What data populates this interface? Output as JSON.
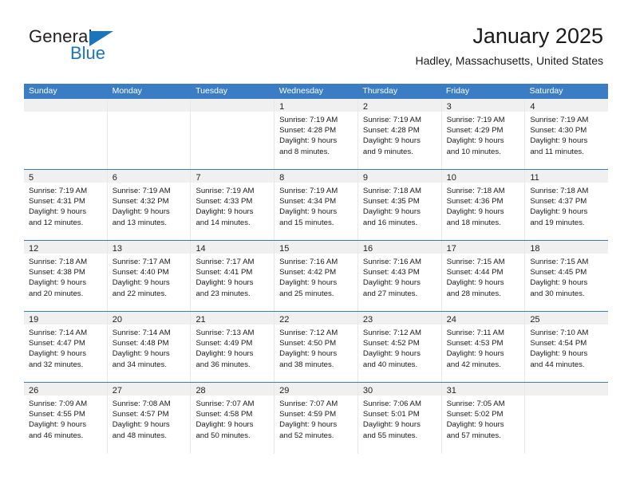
{
  "logo": {
    "word_top": "General",
    "word_bottom": "Blue",
    "triangle_color": "#1b75bb",
    "icon": "triangle-icon"
  },
  "header": {
    "title": "January 2025",
    "subtitle": "Hadley, Massachusetts, United States"
  },
  "theme": {
    "header_blue": "#3b7dc4",
    "day_band_gray": "#f0f0f0",
    "separator_blue": "#3b7dc4",
    "cell_border": "#e8e8e8"
  },
  "weekdays": [
    "Sunday",
    "Monday",
    "Tuesday",
    "Wednesday",
    "Thursday",
    "Friday",
    "Saturday"
  ],
  "weeks": [
    [
      {
        "day": "",
        "lines": []
      },
      {
        "day": "",
        "lines": []
      },
      {
        "day": "",
        "lines": []
      },
      {
        "day": "1",
        "lines": [
          "Sunrise: 7:19 AM",
          "Sunset: 4:28 PM",
          "Daylight: 9 hours",
          "and 8 minutes."
        ]
      },
      {
        "day": "2",
        "lines": [
          "Sunrise: 7:19 AM",
          "Sunset: 4:28 PM",
          "Daylight: 9 hours",
          "and 9 minutes."
        ]
      },
      {
        "day": "3",
        "lines": [
          "Sunrise: 7:19 AM",
          "Sunset: 4:29 PM",
          "Daylight: 9 hours",
          "and 10 minutes."
        ]
      },
      {
        "day": "4",
        "lines": [
          "Sunrise: 7:19 AM",
          "Sunset: 4:30 PM",
          "Daylight: 9 hours",
          "and 11 minutes."
        ]
      }
    ],
    [
      {
        "day": "5",
        "lines": [
          "Sunrise: 7:19 AM",
          "Sunset: 4:31 PM",
          "Daylight: 9 hours",
          "and 12 minutes."
        ]
      },
      {
        "day": "6",
        "lines": [
          "Sunrise: 7:19 AM",
          "Sunset: 4:32 PM",
          "Daylight: 9 hours",
          "and 13 minutes."
        ]
      },
      {
        "day": "7",
        "lines": [
          "Sunrise: 7:19 AM",
          "Sunset: 4:33 PM",
          "Daylight: 9 hours",
          "and 14 minutes."
        ]
      },
      {
        "day": "8",
        "lines": [
          "Sunrise: 7:19 AM",
          "Sunset: 4:34 PM",
          "Daylight: 9 hours",
          "and 15 minutes."
        ]
      },
      {
        "day": "9",
        "lines": [
          "Sunrise: 7:18 AM",
          "Sunset: 4:35 PM",
          "Daylight: 9 hours",
          "and 16 minutes."
        ]
      },
      {
        "day": "10",
        "lines": [
          "Sunrise: 7:18 AM",
          "Sunset: 4:36 PM",
          "Daylight: 9 hours",
          "and 18 minutes."
        ]
      },
      {
        "day": "11",
        "lines": [
          "Sunrise: 7:18 AM",
          "Sunset: 4:37 PM",
          "Daylight: 9 hours",
          "and 19 minutes."
        ]
      }
    ],
    [
      {
        "day": "12",
        "lines": [
          "Sunrise: 7:18 AM",
          "Sunset: 4:38 PM",
          "Daylight: 9 hours",
          "and 20 minutes."
        ]
      },
      {
        "day": "13",
        "lines": [
          "Sunrise: 7:17 AM",
          "Sunset: 4:40 PM",
          "Daylight: 9 hours",
          "and 22 minutes."
        ]
      },
      {
        "day": "14",
        "lines": [
          "Sunrise: 7:17 AM",
          "Sunset: 4:41 PM",
          "Daylight: 9 hours",
          "and 23 minutes."
        ]
      },
      {
        "day": "15",
        "lines": [
          "Sunrise: 7:16 AM",
          "Sunset: 4:42 PM",
          "Daylight: 9 hours",
          "and 25 minutes."
        ]
      },
      {
        "day": "16",
        "lines": [
          "Sunrise: 7:16 AM",
          "Sunset: 4:43 PM",
          "Daylight: 9 hours",
          "and 27 minutes."
        ]
      },
      {
        "day": "17",
        "lines": [
          "Sunrise: 7:15 AM",
          "Sunset: 4:44 PM",
          "Daylight: 9 hours",
          "and 28 minutes."
        ]
      },
      {
        "day": "18",
        "lines": [
          "Sunrise: 7:15 AM",
          "Sunset: 4:45 PM",
          "Daylight: 9 hours",
          "and 30 minutes."
        ]
      }
    ],
    [
      {
        "day": "19",
        "lines": [
          "Sunrise: 7:14 AM",
          "Sunset: 4:47 PM",
          "Daylight: 9 hours",
          "and 32 minutes."
        ]
      },
      {
        "day": "20",
        "lines": [
          "Sunrise: 7:14 AM",
          "Sunset: 4:48 PM",
          "Daylight: 9 hours",
          "and 34 minutes."
        ]
      },
      {
        "day": "21",
        "lines": [
          "Sunrise: 7:13 AM",
          "Sunset: 4:49 PM",
          "Daylight: 9 hours",
          "and 36 minutes."
        ]
      },
      {
        "day": "22",
        "lines": [
          "Sunrise: 7:12 AM",
          "Sunset: 4:50 PM",
          "Daylight: 9 hours",
          "and 38 minutes."
        ]
      },
      {
        "day": "23",
        "lines": [
          "Sunrise: 7:12 AM",
          "Sunset: 4:52 PM",
          "Daylight: 9 hours",
          "and 40 minutes."
        ]
      },
      {
        "day": "24",
        "lines": [
          "Sunrise: 7:11 AM",
          "Sunset: 4:53 PM",
          "Daylight: 9 hours",
          "and 42 minutes."
        ]
      },
      {
        "day": "25",
        "lines": [
          "Sunrise: 7:10 AM",
          "Sunset: 4:54 PM",
          "Daylight: 9 hours",
          "and 44 minutes."
        ]
      }
    ],
    [
      {
        "day": "26",
        "lines": [
          "Sunrise: 7:09 AM",
          "Sunset: 4:55 PM",
          "Daylight: 9 hours",
          "and 46 minutes."
        ]
      },
      {
        "day": "27",
        "lines": [
          "Sunrise: 7:08 AM",
          "Sunset: 4:57 PM",
          "Daylight: 9 hours",
          "and 48 minutes."
        ]
      },
      {
        "day": "28",
        "lines": [
          "Sunrise: 7:07 AM",
          "Sunset: 4:58 PM",
          "Daylight: 9 hours",
          "and 50 minutes."
        ]
      },
      {
        "day": "29",
        "lines": [
          "Sunrise: 7:07 AM",
          "Sunset: 4:59 PM",
          "Daylight: 9 hours",
          "and 52 minutes."
        ]
      },
      {
        "day": "30",
        "lines": [
          "Sunrise: 7:06 AM",
          "Sunset: 5:01 PM",
          "Daylight: 9 hours",
          "and 55 minutes."
        ]
      },
      {
        "day": "31",
        "lines": [
          "Sunrise: 7:05 AM",
          "Sunset: 5:02 PM",
          "Daylight: 9 hours",
          "and 57 minutes."
        ]
      },
      {
        "day": "",
        "lines": []
      }
    ]
  ]
}
